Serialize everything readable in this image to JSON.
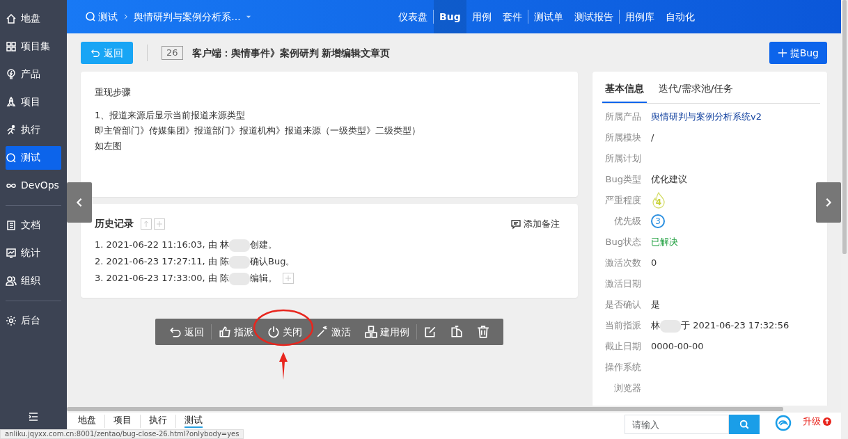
{
  "sidebar": {
    "groups": [
      [
        {
          "label": "地盘",
          "selected": false
        },
        {
          "label": "项目集",
          "selected": false
        },
        {
          "label": "产品",
          "selected": false
        },
        {
          "label": "项目",
          "selected": false
        },
        {
          "label": "执行",
          "selected": false
        },
        {
          "label": "测试",
          "selected": true
        },
        {
          "label": "DevOps",
          "selected": false
        }
      ],
      [
        {
          "label": "文档",
          "selected": false
        },
        {
          "label": "统计",
          "selected": false
        },
        {
          "label": "组织",
          "selected": false
        }
      ],
      [
        {
          "label": "后台",
          "selected": false
        }
      ]
    ]
  },
  "topbar": {
    "module": "测试",
    "product": "舆情研判与案例分析系...",
    "nav_groups": [
      [
        {
          "label": "仪表盘",
          "selected": false
        }
      ],
      [
        {
          "label": "Bug",
          "selected": true
        },
        {
          "label": "用例",
          "selected": false
        },
        {
          "label": "套件",
          "selected": false
        }
      ],
      [
        {
          "label": "测试单",
          "selected": false
        },
        {
          "label": "测试报告",
          "selected": false
        }
      ],
      [
        {
          "label": "用例库",
          "selected": false
        },
        {
          "label": "自动化",
          "selected": false
        }
      ]
    ]
  },
  "header": {
    "back_button": "返回",
    "bug_id": "26",
    "bug_title": "客户端：舆情事件》案例研判 新增编辑文章页",
    "create_button": "提Bug"
  },
  "steps": {
    "heading": "重现步骤",
    "lines": [
      "1、报道来源后显示当前报道来源类型",
      "即主管部门》传媒集团》报道部门》报道机构》报道来源（一级类型》二级类型）",
      "如左图"
    ]
  },
  "history": {
    "heading": "历史记录",
    "add_note": "添加备注",
    "entries": [
      {
        "before": "1. 2021-06-22 11:16:03, 由 林",
        "after": "创建。",
        "expandable": false
      },
      {
        "before": "2. 2021-06-23 17:27:11, 由 陈",
        "after": "确认Bug。",
        "expandable": false
      },
      {
        "before": "3. 2021-06-23 17:33:00, 由 陈",
        "after": "编辑。",
        "expandable": true
      }
    ]
  },
  "actions": [
    [
      {
        "kind": "text",
        "label": "返回"
      }
    ],
    [
      {
        "kind": "text",
        "label": "指派"
      },
      {
        "kind": "text",
        "label": "关闭"
      },
      {
        "kind": "text",
        "label": "激活"
      },
      {
        "kind": "text",
        "label": "建用例"
      }
    ],
    [
      {
        "kind": "icon"
      },
      {
        "kind": "icon"
      },
      {
        "kind": "icon"
      }
    ]
  ],
  "info": {
    "tabs": [
      {
        "label": "基本信息",
        "selected": true
      },
      {
        "label": "迭代/需求池/任务",
        "selected": false
      }
    ],
    "fields": [
      {
        "label": "所属产品",
        "kind": "link",
        "value": "舆情研判与案例分析系统v2"
      },
      {
        "label": "所属模块",
        "kind": "text",
        "value": "/"
      },
      {
        "label": "所属计划",
        "kind": "empty"
      },
      {
        "label": "Bug类型",
        "kind": "text",
        "value": "优化建议"
      },
      {
        "label": "严重程度",
        "kind": "severity",
        "value": "4"
      },
      {
        "label": "优先级",
        "kind": "priority",
        "value": "3"
      },
      {
        "label": "Bug状态",
        "kind": "status",
        "value": "已解决"
      },
      {
        "label": "激活次数",
        "kind": "text",
        "value": "0"
      },
      {
        "label": "激活日期",
        "kind": "empty"
      },
      {
        "label": "是否确认",
        "kind": "text",
        "value": "是"
      },
      {
        "label": "当前指派",
        "kind": "assigned",
        "value": "林",
        "after": "于 2021-06-23 17:32:56"
      },
      {
        "label": "截止日期",
        "kind": "text",
        "value": "0000-00-00"
      },
      {
        "label": "操作系统",
        "kind": "empty"
      },
      {
        "label": "浏览器",
        "kind": "empty"
      }
    ]
  },
  "bottombar": {
    "tabs": [
      {
        "label": "地盘",
        "selected": false
      },
      {
        "label": "项目",
        "selected": false
      },
      {
        "label": "执行",
        "selected": false
      },
      {
        "label": "测试",
        "selected": true
      }
    ],
    "search_placeholder": "请输入",
    "upgrade": "升级"
  },
  "status_url": "anliku.jqyxx.com.cn:8001/zentao/bug-close-26.html?onlybody=yes"
}
